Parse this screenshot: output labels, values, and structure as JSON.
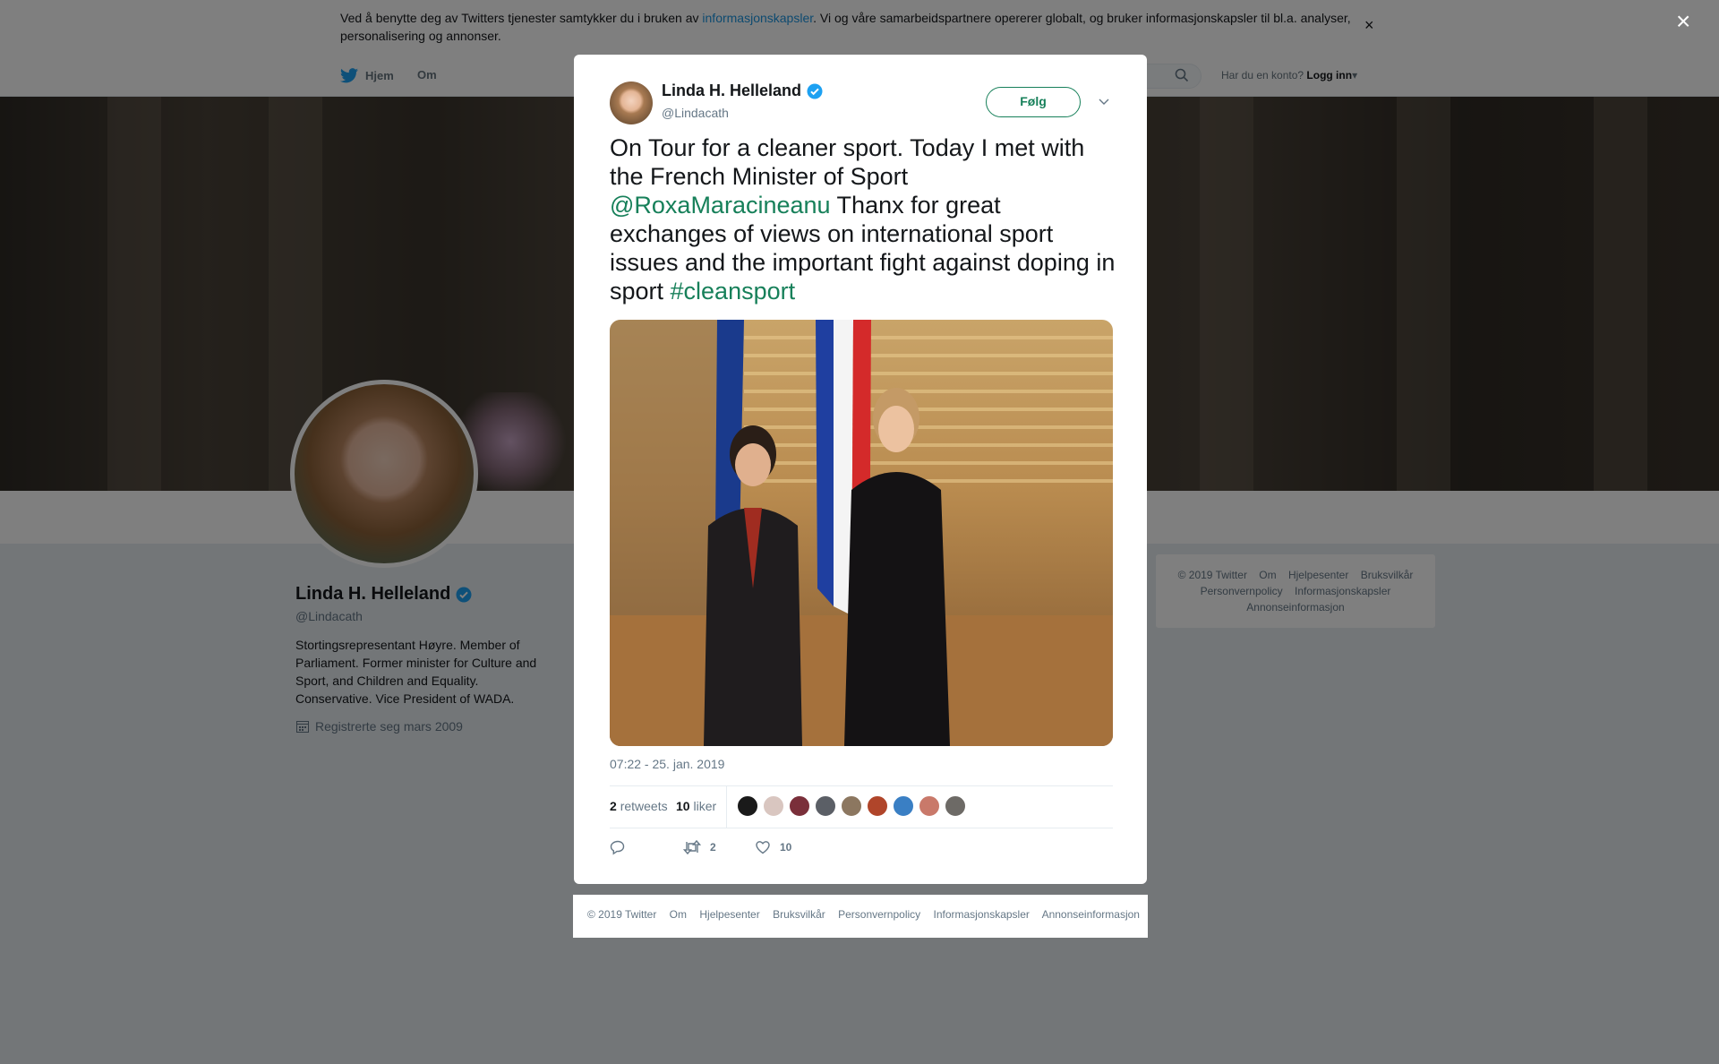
{
  "cookie_bar": {
    "text_before": "Ved å benytte deg av Twitters tjenester samtykker du i bruken av ",
    "link": "informasjonskapsler",
    "text_after": ". Vi og våre samarbeidspartnere opererer globalt, og bruker informasjonskapsler til bl.a. analyser, personalisering og annonser.",
    "close": "×"
  },
  "nav": {
    "home": "Hjem",
    "about": "Om",
    "login_question": "Har du en konto?",
    "login": "Logg inn"
  },
  "profile": {
    "name": "Linda H. Helleland",
    "handle": "@Lindacath",
    "bio": "Stortingsrepresentant Høyre. Member of Parliament. Former minister for Culture and Sport, and Children and Equality. Conservative. Vice President of WADA.",
    "joined": "Registrerte seg mars 2009"
  },
  "side_footer": {
    "items": [
      "© 2019 Twitter",
      "Om",
      "Hjelpesenter",
      "Bruksvilkår",
      "Personvernpolicy",
      "Informasjonskapsler",
      "Annonseinformasjon"
    ]
  },
  "overlay": {
    "close": "×"
  },
  "tweet": {
    "name": "Linda H. Helleland",
    "handle": "@Lindacath",
    "follow": "Følg",
    "text_1": "On Tour for a cleaner sport. Today I met with the French Minister of Sport ",
    "mention": "@RoxaMaracineanu",
    "text_2": " Thanx for great exchanges of views on international sport issues and the important fight against doping in sport ",
    "hashtag": "#cleansport",
    "date": "07:22 - 25. jan. 2019",
    "retweets_count": "2",
    "retweets_label": "retweets",
    "likes_count": "10",
    "likes_label": "liker",
    "action_retweets": "2",
    "action_likes": "10"
  },
  "modal_footer": {
    "items": [
      "© 2019 Twitter",
      "Om",
      "Hjelpesenter",
      "Bruksvilkår",
      "Personvernpolicy",
      "Informasjonskapsler",
      "Annonseinformasjon"
    ]
  },
  "colors": {
    "accent": "#17805a",
    "twitter_blue": "#1b95e0",
    "verified": "#1da1f2",
    "secondary_text": "#657786"
  }
}
